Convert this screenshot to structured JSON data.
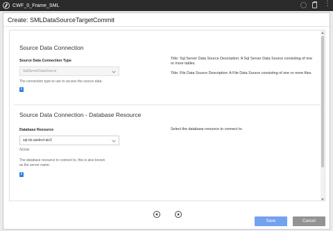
{
  "window": {
    "title": "CWF_0_Frame_SML"
  },
  "dialog": {
    "title": "Create: SMLDataSourceTargetCommit"
  },
  "section1": {
    "title": "Source Data Connection",
    "field_label": "Source Data Connection Type",
    "select_value": "SqlServerDataSource",
    "help_text": "The connection type to use to access the source data.",
    "desc1": "Title: Sql Server Data Source Description: A Sql Server Data Source consisting of one or more tables.",
    "desc2": "Title: File Data Source Description: A File Data Source consisting of one or more files."
  },
  "section2": {
    "title": "Source Data Connection - Database Resource",
    "field_label": "Database Resource",
    "select_value": "sql-ds-aisdevt-ais3",
    "none_text": "None",
    "help_text": "The database resource to connect to, this is also known as the server name.",
    "desc": "Select the database resource to connect to."
  },
  "footer": {
    "save_label": "Save",
    "cancel_label": "Cancel"
  }
}
